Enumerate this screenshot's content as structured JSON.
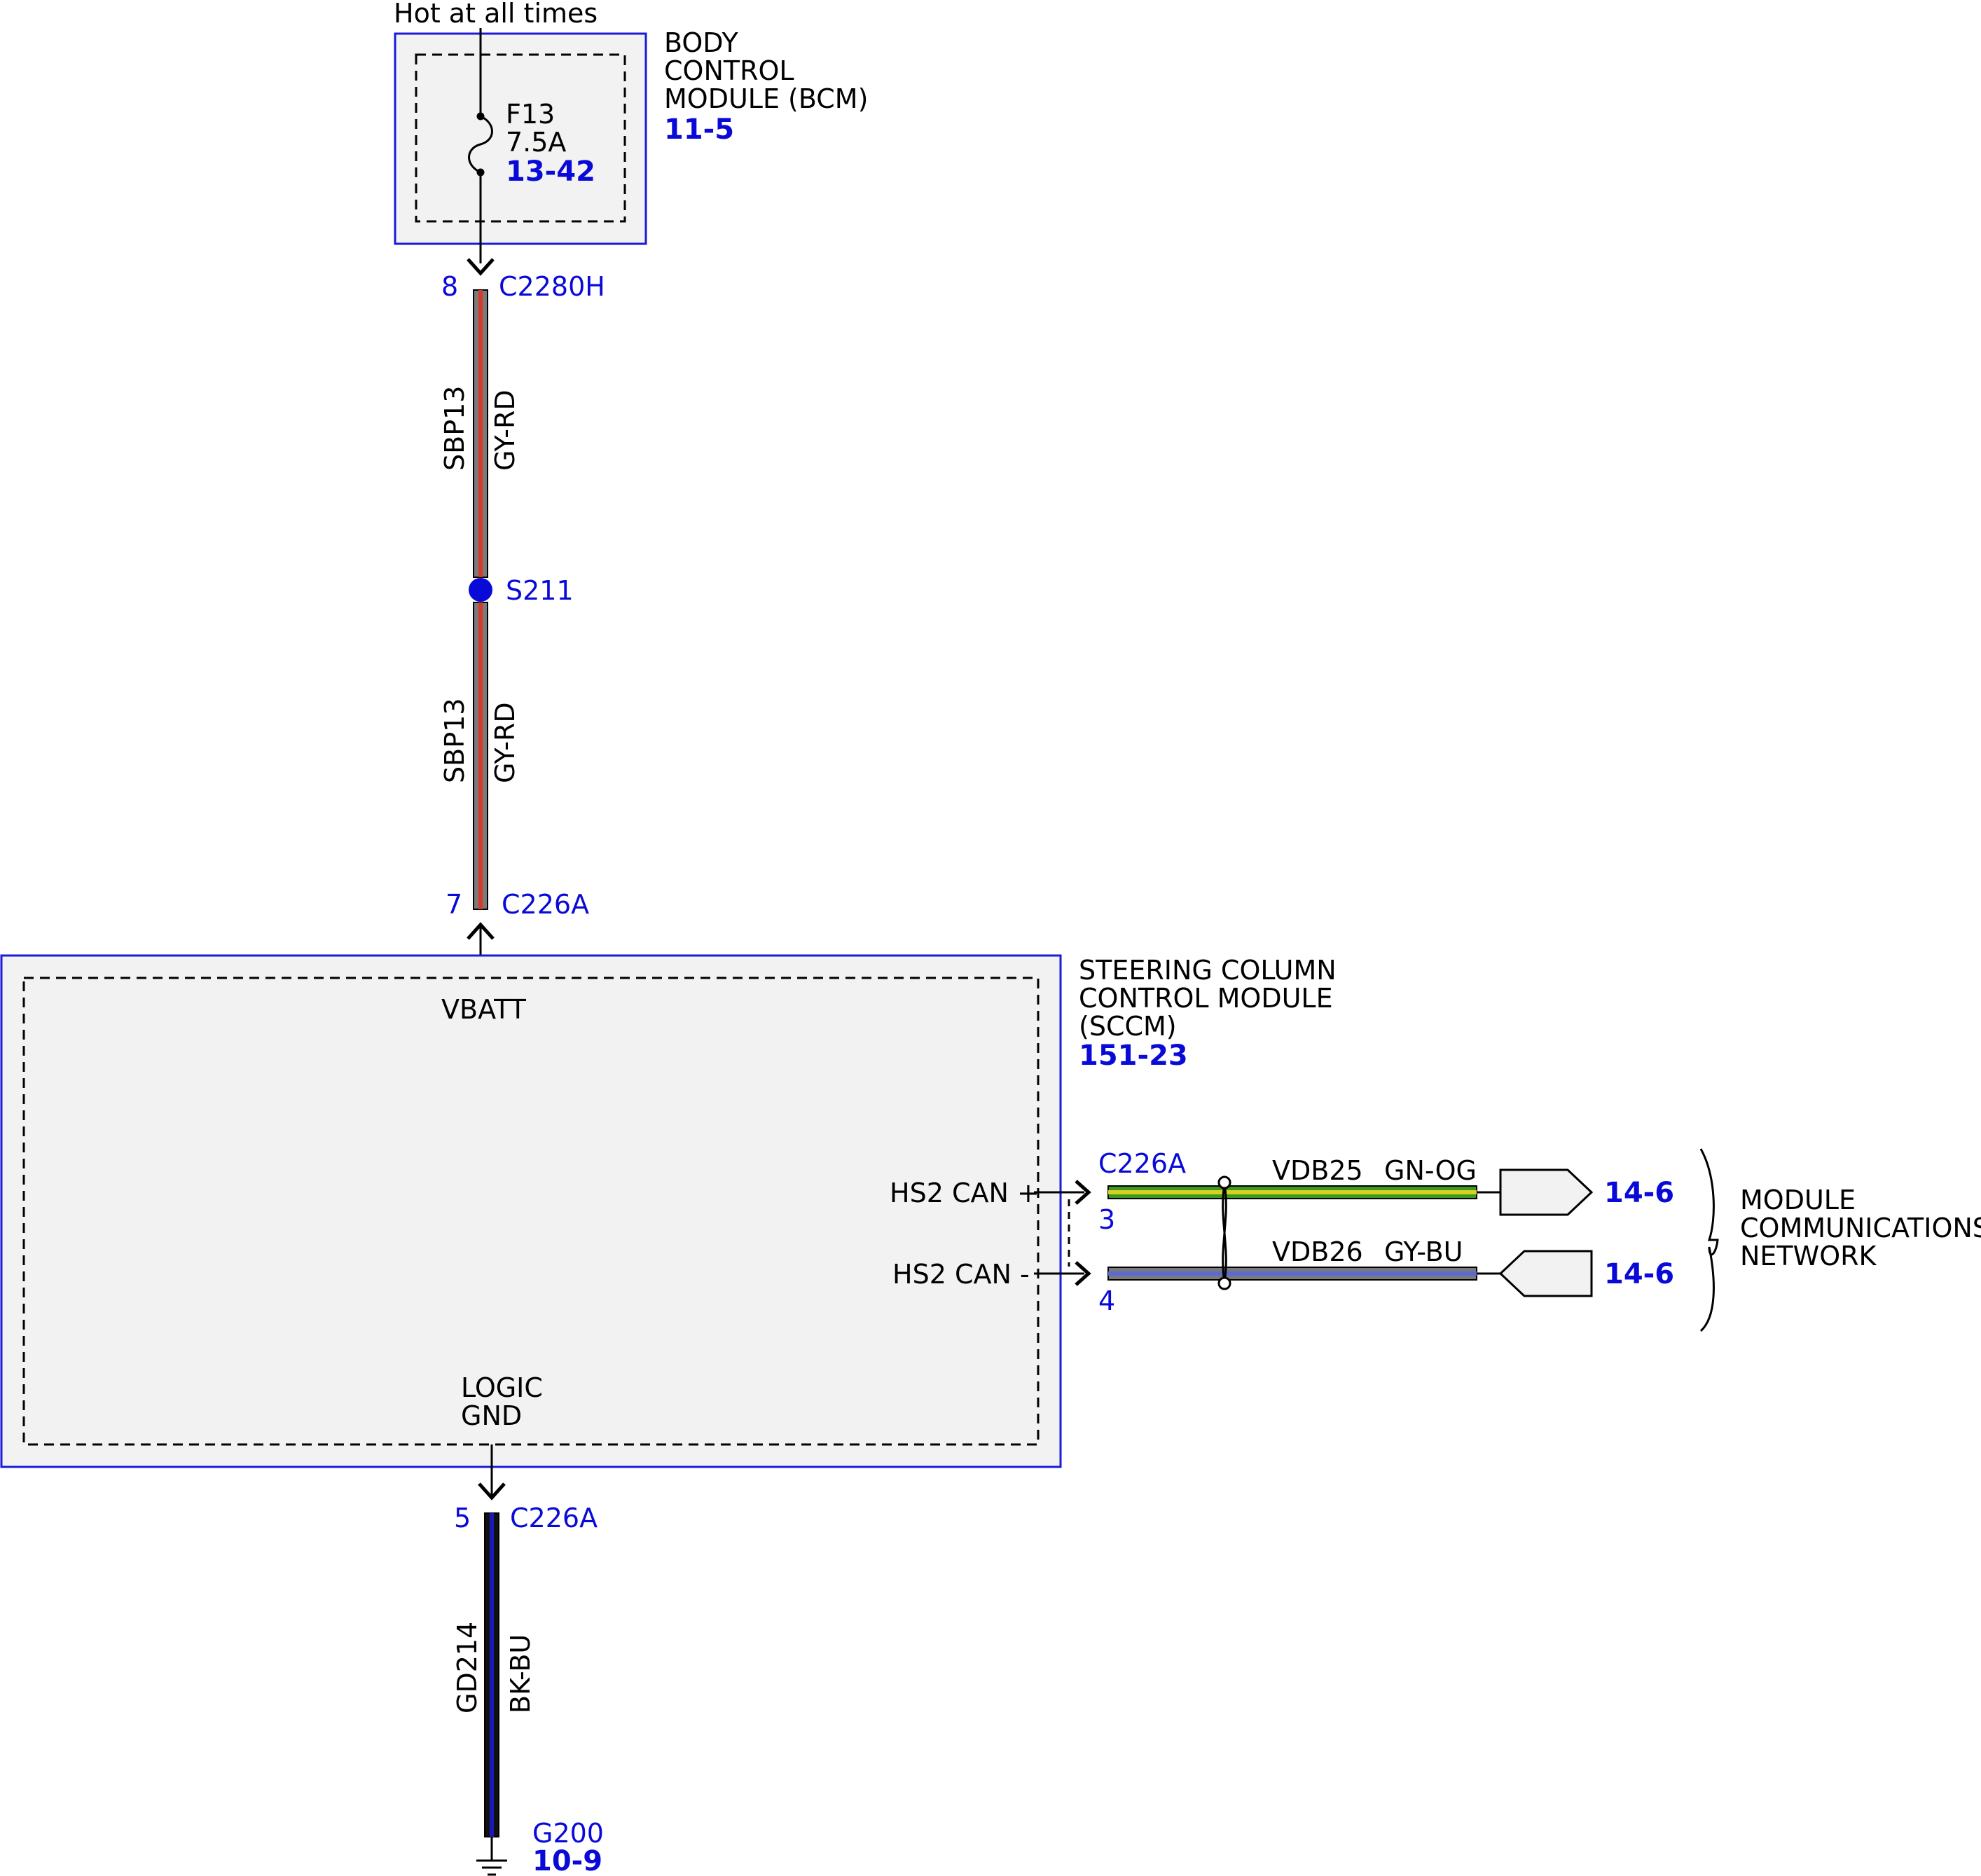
{
  "top_note": "Hot at all times",
  "colors": {
    "module_border": "#1a1ad8",
    "module_fill": "#f2f2f2",
    "blue_text": "#0a0ad8",
    "gray": "#7a7a7a",
    "red": "#d83a2a",
    "green": "#3a9a20",
    "yellow": "#d8d020",
    "blue_stripe": "#5a6ad0",
    "black": "#111111",
    "dark_blue": "#1a1ab8"
  },
  "bcm": {
    "name_lines": [
      "BODY",
      "CONTROL",
      "MODULE (BCM)"
    ],
    "ref": "11-5",
    "fuse": {
      "id": "F13",
      "rating": "7.5A",
      "ref": "13-42"
    }
  },
  "wire_top": {
    "connector": "C2280H",
    "pin": "8",
    "circuit": "SBP13",
    "color": "GY-RD"
  },
  "splice": {
    "id": "S211"
  },
  "wire_mid": {
    "circuit": "SBP13",
    "color": "GY-RD",
    "connector": "C226A",
    "pin": "7"
  },
  "sccm": {
    "name_lines": [
      "STEERING COLUMN",
      "CONTROL MODULE",
      "(SCCM)"
    ],
    "ref": "151-23",
    "vbatt_label": "VBATT",
    "logic_gnd_lines": [
      "LOGIC",
      "GND"
    ],
    "can_plus_label": "HS2 CAN +",
    "can_minus_label": "HS2 CAN -"
  },
  "can_bus": {
    "connector": "C226A",
    "plus": {
      "pin": "3",
      "circuit": "VDB25",
      "color": "GN-OG",
      "ref": "14-6"
    },
    "minus": {
      "pin": "4",
      "circuit": "VDB26",
      "color": "GY-BU",
      "ref": "14-6"
    },
    "network_lines": [
      "MODULE",
      "COMMUNICATIONS",
      "NETWORK"
    ]
  },
  "ground_wire": {
    "connector": "C226A",
    "pin": "5",
    "circuit": "GD214",
    "color": "BK-BU",
    "ground": "G200",
    "ref": "10-9"
  }
}
